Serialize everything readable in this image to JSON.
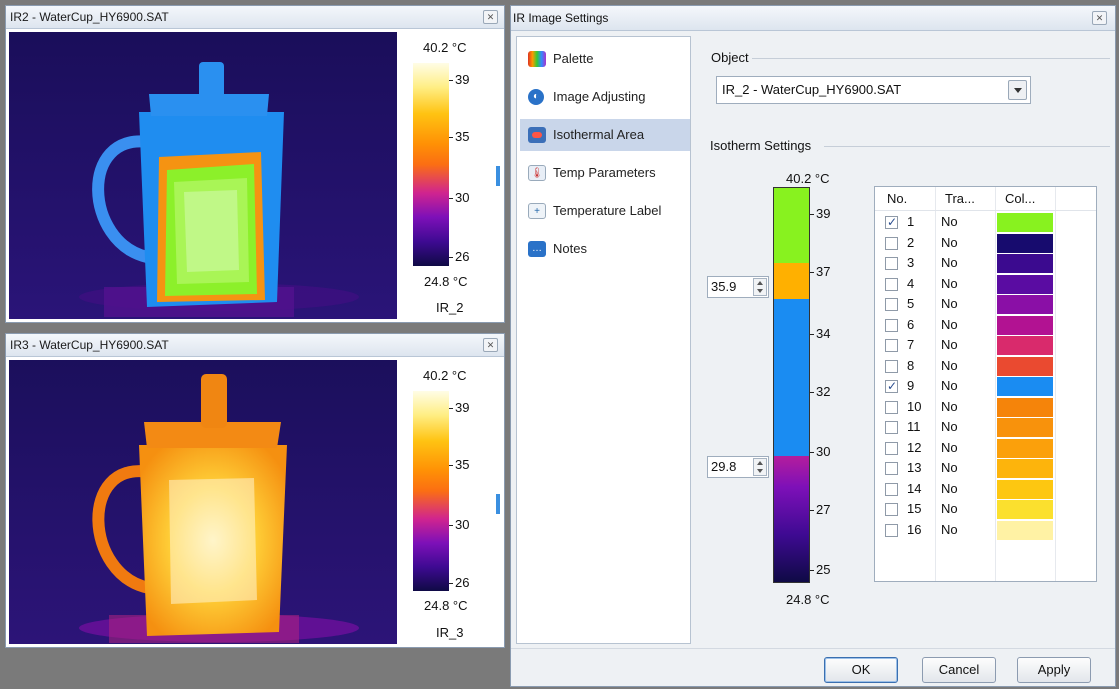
{
  "thermal_views": [
    {
      "title": "IR2 - WaterCup_HY6900.SAT",
      "scale_max": "40.2 °C",
      "scale_min": "24.8 °C",
      "scale_ticks": [
        "39",
        "35",
        "30",
        "26"
      ],
      "image_name": "IR_2"
    },
    {
      "title": "IR3 - WaterCup_HY6900.SAT",
      "scale_max": "40.2 °C",
      "scale_min": "24.8 °C",
      "scale_ticks": [
        "39",
        "35",
        "30",
        "26"
      ],
      "image_name": "IR_3"
    }
  ],
  "dialog": {
    "title": "IR Image Settings",
    "nav": [
      {
        "label": "Palette",
        "icon": "palette-icon"
      },
      {
        "label": "Image Adjusting",
        "icon": "contrast-icon"
      },
      {
        "label": "Isothermal Area",
        "icon": "isotherm-icon",
        "selected": true
      },
      {
        "label": "Temp Parameters",
        "icon": "thermometer-icon"
      },
      {
        "label": "Temperature Label",
        "icon": "temp-label-icon"
      },
      {
        "label": "Notes",
        "icon": "notes-icon"
      }
    ],
    "object_group_label": "Object",
    "object_value": "IR_2 - WaterCup_HY6900.SAT",
    "isotherm_group_label": "Isotherm Settings",
    "bar_max": "40.2 °C",
    "bar_min": "24.8 °C",
    "bar_ticks": [
      "39",
      "37",
      "34",
      "32",
      "30",
      "27",
      "25"
    ],
    "spinner_upper": "35.9",
    "spinner_lower": "29.8",
    "table_headers": {
      "no": "No.",
      "trans": "Tra...",
      "color": "Col..."
    },
    "rows": [
      {
        "no": "1",
        "trans": "No",
        "checked": true,
        "color": "#88f21f"
      },
      {
        "no": "2",
        "trans": "No",
        "checked": false,
        "color": "#170b6e"
      },
      {
        "no": "3",
        "trans": "No",
        "checked": false,
        "color": "#3b0a8f"
      },
      {
        "no": "4",
        "trans": "No",
        "checked": false,
        "color": "#5a0ca2"
      },
      {
        "no": "5",
        "trans": "No",
        "checked": false,
        "color": "#8a0fa6"
      },
      {
        "no": "6",
        "trans": "No",
        "checked": false,
        "color": "#b21292"
      },
      {
        "no": "7",
        "trans": "No",
        "checked": false,
        "color": "#d92a6c"
      },
      {
        "no": "8",
        "trans": "No",
        "checked": false,
        "color": "#ea4a30"
      },
      {
        "no": "9",
        "trans": "No",
        "checked": true,
        "color": "#1a8cf2"
      },
      {
        "no": "10",
        "trans": "No",
        "checked": false,
        "color": "#f5840a"
      },
      {
        "no": "11",
        "trans": "No",
        "checked": false,
        "color": "#f8920c"
      },
      {
        "no": "12",
        "trans": "No",
        "checked": false,
        "color": "#fba00b"
      },
      {
        "no": "13",
        "trans": "No",
        "checked": false,
        "color": "#fdb40c"
      },
      {
        "no": "14",
        "trans": "No",
        "checked": false,
        "color": "#fdc711"
      },
      {
        "no": "15",
        "trans": "No",
        "checked": false,
        "color": "#fbe02e"
      },
      {
        "no": "16",
        "trans": "No",
        "checked": false,
        "color": "#fff2a4"
      }
    ],
    "iso_band_colors": {
      "upper": "#88f21f",
      "lower": "#1a8cf2",
      "mid": "#ffb000"
    },
    "buttons": {
      "ok": "OK",
      "cancel": "Cancel",
      "apply": "Apply"
    }
  }
}
